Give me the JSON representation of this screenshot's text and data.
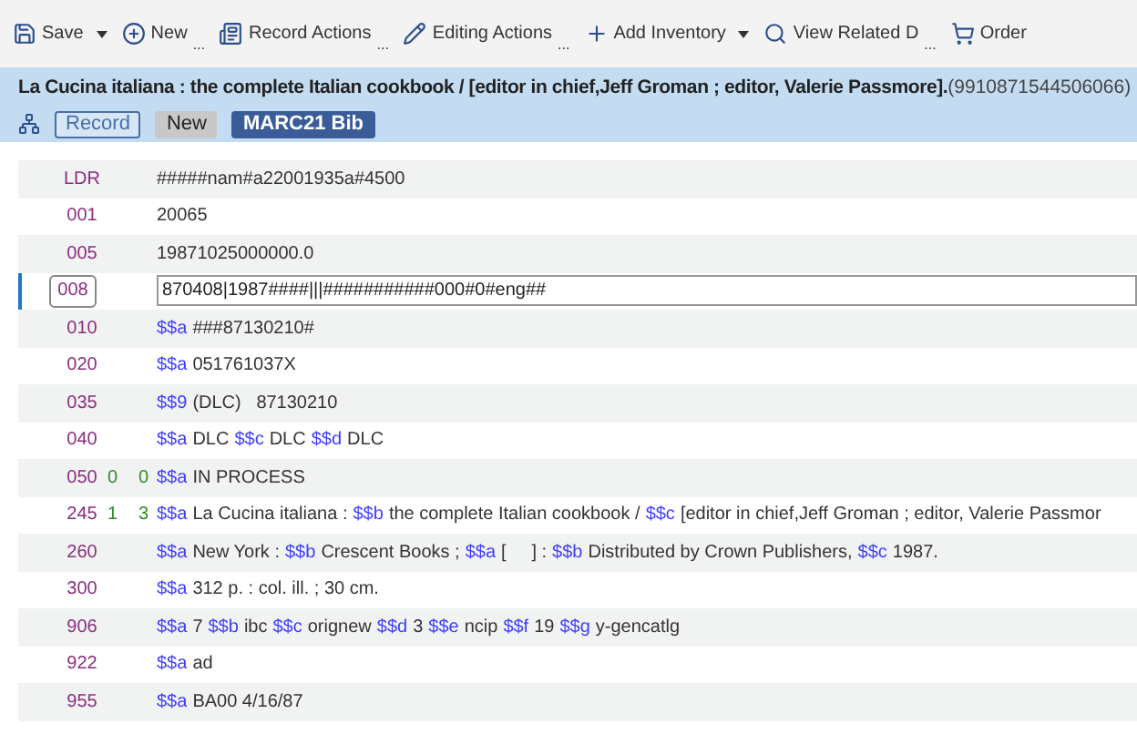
{
  "toolbar": [
    {
      "label": "Save",
      "has_menu": true
    },
    {
      "label": "New",
      "has_menu": false,
      "more": "..."
    },
    {
      "label": "Record Actions",
      "has_menu": false,
      "more": "..."
    },
    {
      "label": "Editing Actions",
      "has_menu": false,
      "more": "..."
    },
    {
      "label": "Add Inventory",
      "has_menu": true
    },
    {
      "label": "View Related D",
      "has_menu": false,
      "more": "..."
    },
    {
      "label": "Order",
      "has_menu": false
    }
  ],
  "record_header": {
    "title": "La Cucina italiana : the complete Italian cookbook / [editor in chief,Jeff Groman ; editor, Valerie Passmore].",
    "record_id": "(9910871544506066)",
    "badges": [
      {
        "label": "Record",
        "kind": "outline"
      },
      {
        "label": "New",
        "kind": "muted"
      },
      {
        "label": "MARC21 Bib",
        "kind": "solid"
      }
    ]
  },
  "fields": [
    {
      "tag": "LDR",
      "selected": false,
      "value": "#####nam#a22001935a#4500"
    },
    {
      "tag": "001",
      "selected": false,
      "value": "20065"
    },
    {
      "tag": "005",
      "selected": false,
      "value": "19871025000000.0"
    },
    {
      "tag": "008",
      "selected": true,
      "value": "870408|1987####|||###########000#0#eng##"
    },
    {
      "tag": "010",
      "selected": false,
      "subfields": [
        {
          "code": "$$a",
          "text": "###87130210#"
        }
      ]
    },
    {
      "tag": "020",
      "selected": false,
      "subfields": [
        {
          "code": "$$a",
          "text": "051761037X"
        }
      ]
    },
    {
      "tag": "035",
      "selected": false,
      "subfields": [
        {
          "code": "$$9",
          "text": "(DLC)   87130210"
        }
      ]
    },
    {
      "tag": "040",
      "selected": false,
      "subfields": [
        {
          "code": "$$a",
          "text": "DLC"
        },
        {
          "code": "$$c",
          "text": "DLC"
        },
        {
          "code": "$$d",
          "text": "DLC"
        }
      ]
    },
    {
      "tag": "050",
      "ind1": "0",
      "ind2": "0",
      "selected": false,
      "subfields": [
        {
          "code": "$$a",
          "text": "IN PROCESS"
        }
      ]
    },
    {
      "tag": "245",
      "ind1": "1",
      "ind2": "3",
      "selected": false,
      "subfields": [
        {
          "code": "$$a",
          "text": "La Cucina italiana :"
        },
        {
          "code": "$$b",
          "text": "the complete Italian cookbook /"
        },
        {
          "code": "$$c",
          "text": "[editor in chief,Jeff Groman ; editor, Valerie Passmor"
        }
      ]
    },
    {
      "tag": "260",
      "selected": false,
      "subfields": [
        {
          "code": "$$a",
          "text": "New York :"
        },
        {
          "code": "$$b",
          "text": "Crescent Books ;"
        },
        {
          "code": "$$a",
          "text": "[     ] :"
        },
        {
          "code": "$$b",
          "text": "Distributed by Crown Publishers,"
        },
        {
          "code": "$$c",
          "text": "1987."
        }
      ]
    },
    {
      "tag": "300",
      "selected": false,
      "subfields": [
        {
          "code": "$$a",
          "text": "312 p. : col. ill. ; 30 cm."
        }
      ]
    },
    {
      "tag": "906",
      "selected": false,
      "subfields": [
        {
          "code": "$$a",
          "text": "7"
        },
        {
          "code": "$$b",
          "text": "ibc"
        },
        {
          "code": "$$c",
          "text": "orignew"
        },
        {
          "code": "$$d",
          "text": "3"
        },
        {
          "code": "$$e",
          "text": "ncip"
        },
        {
          "code": "$$f",
          "text": "19"
        },
        {
          "code": "$$g",
          "text": "y-gencatlg"
        }
      ]
    },
    {
      "tag": "922",
      "selected": false,
      "subfields": [
        {
          "code": "$$a",
          "text": "ad"
        }
      ]
    },
    {
      "tag": "955",
      "selected": false,
      "subfields": [
        {
          "code": "$$a",
          "text": "BA00 4/16/87"
        }
      ]
    }
  ]
}
